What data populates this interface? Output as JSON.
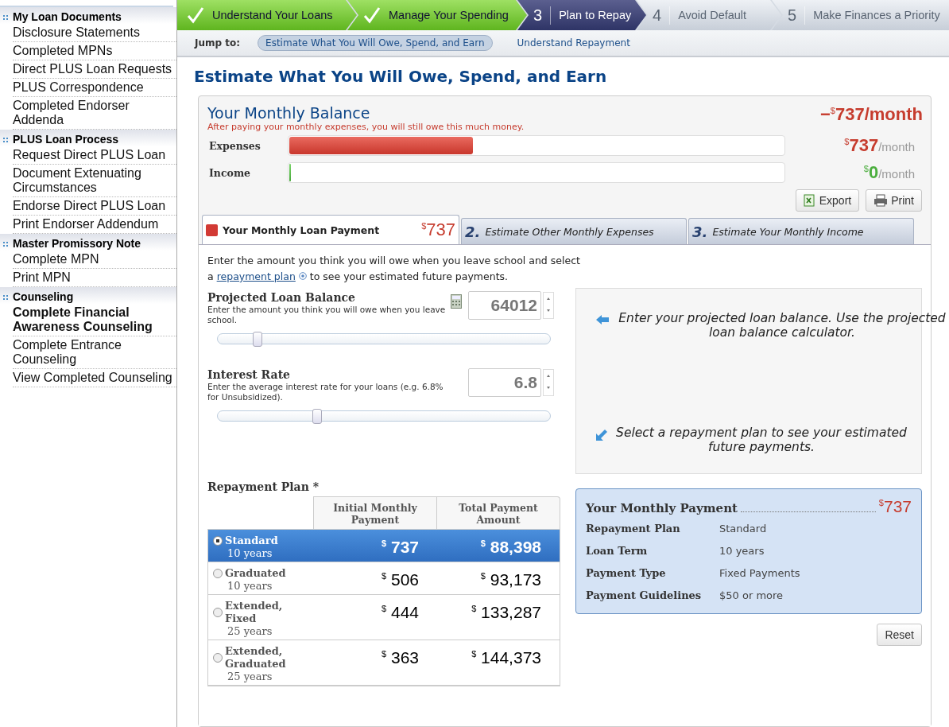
{
  "sidebar": {
    "sections": [
      {
        "title": "My Loan Documents",
        "items": [
          {
            "label": "Disclosure Statements",
            "selected": false
          },
          {
            "label": "Completed MPNs",
            "selected": false
          },
          {
            "label": "Direct PLUS Loan Requests",
            "selected": false
          },
          {
            "label": "PLUS Correspondence",
            "selected": false
          },
          {
            "label": "Completed Endorser Addenda",
            "selected": false
          }
        ]
      },
      {
        "title": "PLUS Loan Process",
        "items": [
          {
            "label": "Request Direct PLUS Loan",
            "selected": false
          },
          {
            "label": "Document Extenuating Circumstances",
            "selected": false
          },
          {
            "label": "Endorse Direct PLUS Loan",
            "selected": false
          },
          {
            "label": "Print Endorser Addendum",
            "selected": false
          }
        ]
      },
      {
        "title": "Master Promissory Note",
        "items": [
          {
            "label": "Complete MPN",
            "selected": false
          },
          {
            "label": "Print MPN",
            "selected": false
          }
        ]
      },
      {
        "title": "Counseling",
        "items": [
          {
            "label": "Complete Financial Awareness Counseling",
            "selected": true
          },
          {
            "label": "Complete Entrance Counseling",
            "selected": false
          },
          {
            "label": "View Completed Counseling",
            "selected": false
          }
        ]
      }
    ]
  },
  "steps": [
    {
      "kind": "done",
      "label": "Understand Your Loans"
    },
    {
      "kind": "done",
      "label": "Manage Your Spending"
    },
    {
      "kind": "current",
      "number": "3",
      "label": "Plan to Repay"
    },
    {
      "kind": "todo",
      "number": "4",
      "label": "Avoid Default"
    },
    {
      "kind": "todo",
      "number": "5",
      "label": "Make Finances a Priority"
    }
  ],
  "jump": {
    "label": "Jump to:",
    "links": [
      {
        "label": "Estimate What You Will Owe, Spend, and Earn",
        "selected": true
      },
      {
        "label": "Understand Repayment",
        "selected": false
      }
    ]
  },
  "page_title": "Estimate What You Will Owe, Spend, and Earn",
  "balance": {
    "title": "Your Monthly Balance",
    "total_sign": "−",
    "total_currency": "$",
    "total": "737/month",
    "note": "After paying your monthly expenses, you will still owe this much money.",
    "bars": [
      {
        "label": "Expenses",
        "kind": "expense",
        "level": 0.37,
        "currency": "$",
        "amount": "737",
        "unit": "/month"
      },
      {
        "label": "Income",
        "kind": "income",
        "level": 0,
        "currency": "$",
        "amount": "0",
        "unit": "/month"
      }
    ],
    "buttons": [
      {
        "kind": "export",
        "label": "Export"
      },
      {
        "kind": "print",
        "label": "Print"
      }
    ]
  },
  "tabs": [
    {
      "label": "Your Monthly Loan Payment",
      "currency": "$",
      "amount": "737",
      "selected": true
    },
    {
      "number": "2.",
      "label": "Estimate Other Monthly Expenses",
      "selected": false
    },
    {
      "number": "3.",
      "label": "Estimate Your Monthly Income",
      "selected": false
    }
  ],
  "intro": {
    "before": "Enter the amount you think you will owe when you leave school and select a",
    "link": "repayment plan",
    "after": "to see your estimated future payments."
  },
  "inputs": [
    {
      "label": "Projected Loan Balance",
      "hint": "Enter the amount you think you will owe when you leave school.",
      "value": "64012",
      "calculator": true,
      "level": 0.12
    },
    {
      "label": "Interest Rate",
      "hint": "Enter the average interest rate for your loans (e.g. 6.8% for Unsubsidized).",
      "value": "6.8",
      "calculator": false,
      "level": 0.3
    }
  ],
  "tips": [
    {
      "kind": "left",
      "text": "Enter your projected loan balance. Use the projected loan balance calculator."
    },
    {
      "kind": "down",
      "text": "Select a repayment plan to see your estimated future payments."
    }
  ],
  "plans": {
    "title": "Repayment Plan *",
    "columns": [
      "Initial Monthly Payment",
      "Total Payment Amount"
    ],
    "rows": [
      {
        "name": "Standard",
        "term": "10 years",
        "currency": "$",
        "monthly": "737",
        "total": "88,398",
        "selected": true
      },
      {
        "name": "Graduated",
        "term": "10 years",
        "currency": "$",
        "monthly": "506",
        "total": "93,173",
        "selected": false
      },
      {
        "name": "Extended, Fixed",
        "term": "25 years",
        "currency": "$",
        "monthly": "444",
        "total": "133,287",
        "selected": false
      },
      {
        "name": "Extended, Graduated",
        "term": "25 years",
        "currency": "$",
        "monthly": "363",
        "total": "144,373",
        "selected": false
      }
    ]
  },
  "summary": {
    "title": "Your Monthly Payment",
    "currency": "$",
    "amount": "737",
    "rows": [
      {
        "label": "Repayment Plan",
        "value": "Standard"
      },
      {
        "label": "Loan Term",
        "value": "10 years"
      },
      {
        "label": "Payment Type",
        "value": "Fixed Payments"
      },
      {
        "label": "Payment Guidelines",
        "value": "$50 or more"
      }
    ]
  },
  "reset": "Reset"
}
